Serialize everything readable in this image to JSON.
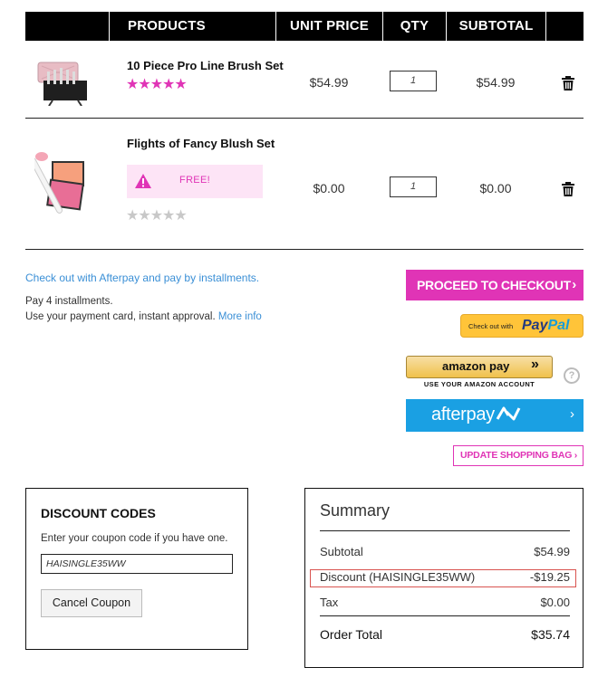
{
  "table_header": {
    "products": "PRODUCTS",
    "unit_price": "UNIT PRICE",
    "qty": "QTY",
    "subtotal": "SUBTOTAL"
  },
  "items": [
    {
      "name": "10 Piece Pro Line Brush Set",
      "rating": 5,
      "unit_price": "$54.99",
      "qty": "1",
      "subtotal": "$54.99"
    },
    {
      "name": "Flights of Fancy Blush Set",
      "badge": "FREE!",
      "rating": 0,
      "unit_price": "$0.00",
      "qty": "1",
      "subtotal": "$0.00"
    }
  ],
  "checkout": {
    "afterpay_link": "Check out with Afterpay and pay by installments.",
    "pay4": "Pay 4 installments.",
    "payment_card_text": "Use your payment card, instant approval.",
    "more_info": "More info",
    "proceed_label": "PROCEED TO CHECKOUT",
    "paypal_prefix": "Check out with",
    "paypal_pay": "Pay",
    "paypal_pal": "Pal",
    "amazon_label": "amazon pay",
    "amazon_sub": "USE YOUR AMAZON ACCOUNT",
    "afterpay_label": "afterpay",
    "update_bag": "UPDATE SHOPPING BAG"
  },
  "discount": {
    "title": "DISCOUNT CODES",
    "hint": "Enter your coupon code if you have one.",
    "code_value": "HAISINGLE35WW",
    "cancel_label": "Cancel Coupon"
  },
  "summary": {
    "title": "Summary",
    "subtotal_label": "Subtotal",
    "subtotal_value": "$54.99",
    "discount_label": "Discount (HAISINGLE35WW)",
    "discount_value": "-$19.25",
    "tax_label": "Tax",
    "tax_value": "$0.00",
    "total_label": "Order Total",
    "total_value": "$35.74"
  },
  "colors": {
    "accent_pink": "#e034b6",
    "afterpay_blue": "#1aa0e3",
    "paypal_yellow": "#ffc439",
    "link_blue": "#3a8fd6"
  },
  "icons": [
    "trash-icon",
    "warning-icon",
    "chevron-right-icon",
    "help-icon",
    "star-icon"
  ]
}
